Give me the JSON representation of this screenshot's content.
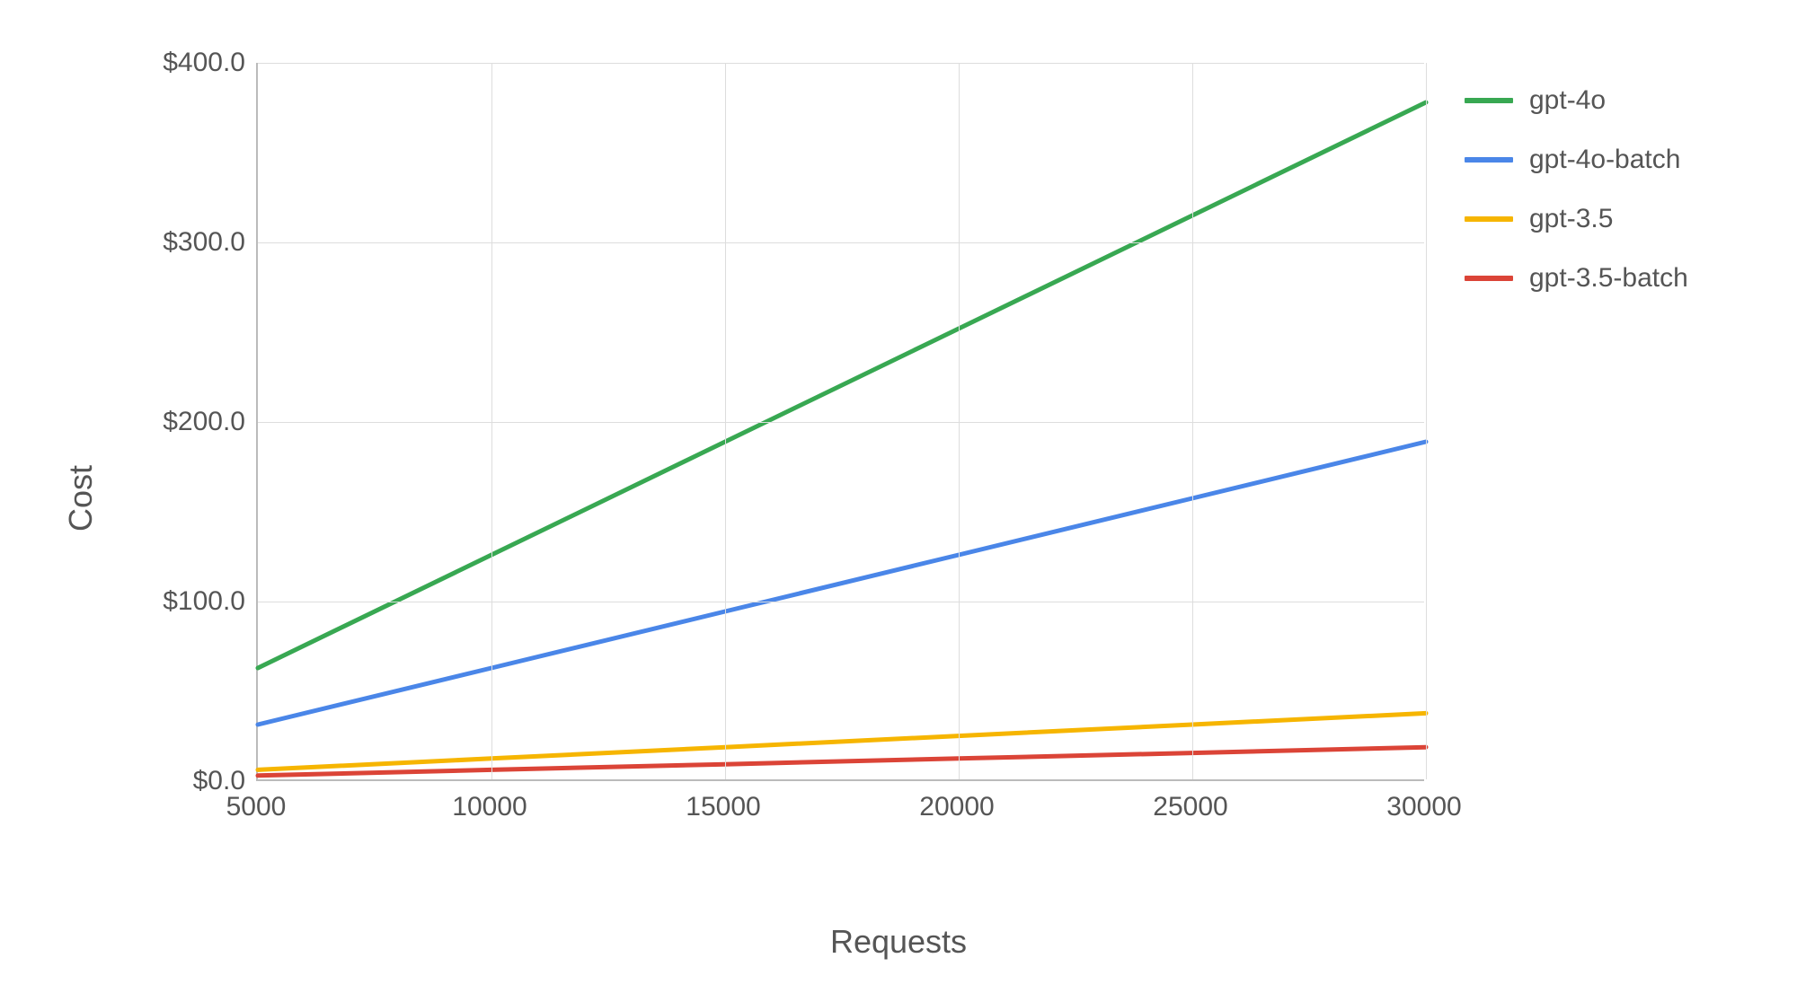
{
  "chart_data": {
    "type": "line",
    "title": "",
    "xlabel": "Requests",
    "ylabel": "Cost",
    "xlim": [
      5000,
      30000
    ],
    "ylim": [
      0,
      400
    ],
    "x_ticks": [
      5000,
      10000,
      15000,
      20000,
      25000,
      30000
    ],
    "y_ticks": [
      0,
      100,
      200,
      300,
      400
    ],
    "y_tick_labels": [
      "$0.0",
      "$100.0",
      "$200.0",
      "$300.0",
      "$400.0"
    ],
    "x": [
      5000,
      10000,
      15000,
      20000,
      25000,
      30000
    ],
    "series": [
      {
        "name": "gpt-4o",
        "color": "#38a852",
        "values": [
          63.0,
          126.0,
          189.0,
          252.0,
          315.0,
          378.0
        ]
      },
      {
        "name": "gpt-4o-batch",
        "color": "#4a86e8",
        "values": [
          31.5,
          63.0,
          94.5,
          126.0,
          157.5,
          189.0
        ]
      },
      {
        "name": "gpt-3.5",
        "color": "#f6b500",
        "values": [
          6.3,
          12.6,
          18.9,
          25.2,
          31.5,
          37.8
        ]
      },
      {
        "name": "gpt-3.5-batch",
        "color": "#db4437",
        "values": [
          3.1,
          6.3,
          9.4,
          12.6,
          15.7,
          18.9
        ]
      }
    ],
    "legend_position": "right",
    "grid": true
  }
}
